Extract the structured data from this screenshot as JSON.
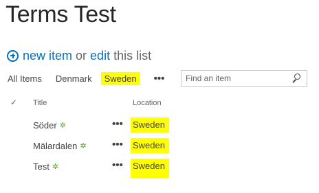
{
  "page": {
    "title": "Terms Test"
  },
  "command": {
    "new_item": "new item",
    "or": "or",
    "edit": "edit",
    "this_list": "this list"
  },
  "views": [
    {
      "label": "All Items",
      "selected": false
    },
    {
      "label": "Denmark",
      "selected": false
    },
    {
      "label": "Sweden",
      "selected": true
    }
  ],
  "more_label": "•••",
  "search": {
    "placeholder": "Find an item",
    "icon": "search-icon"
  },
  "table": {
    "headers": {
      "check": "✓",
      "title": "Title",
      "location": "Location"
    },
    "rows": [
      {
        "title": "Söder",
        "new_badge": "✲",
        "location": "Sweden"
      },
      {
        "title": "Mälardalen",
        "new_badge": "✲",
        "location": "Sweden"
      },
      {
        "title": "Test",
        "new_badge": "✲",
        "location": "Sweden"
      }
    ]
  },
  "colors": {
    "accent": "#0072c6",
    "highlight": "#ffff00",
    "new_badge": "#5aa02c"
  }
}
